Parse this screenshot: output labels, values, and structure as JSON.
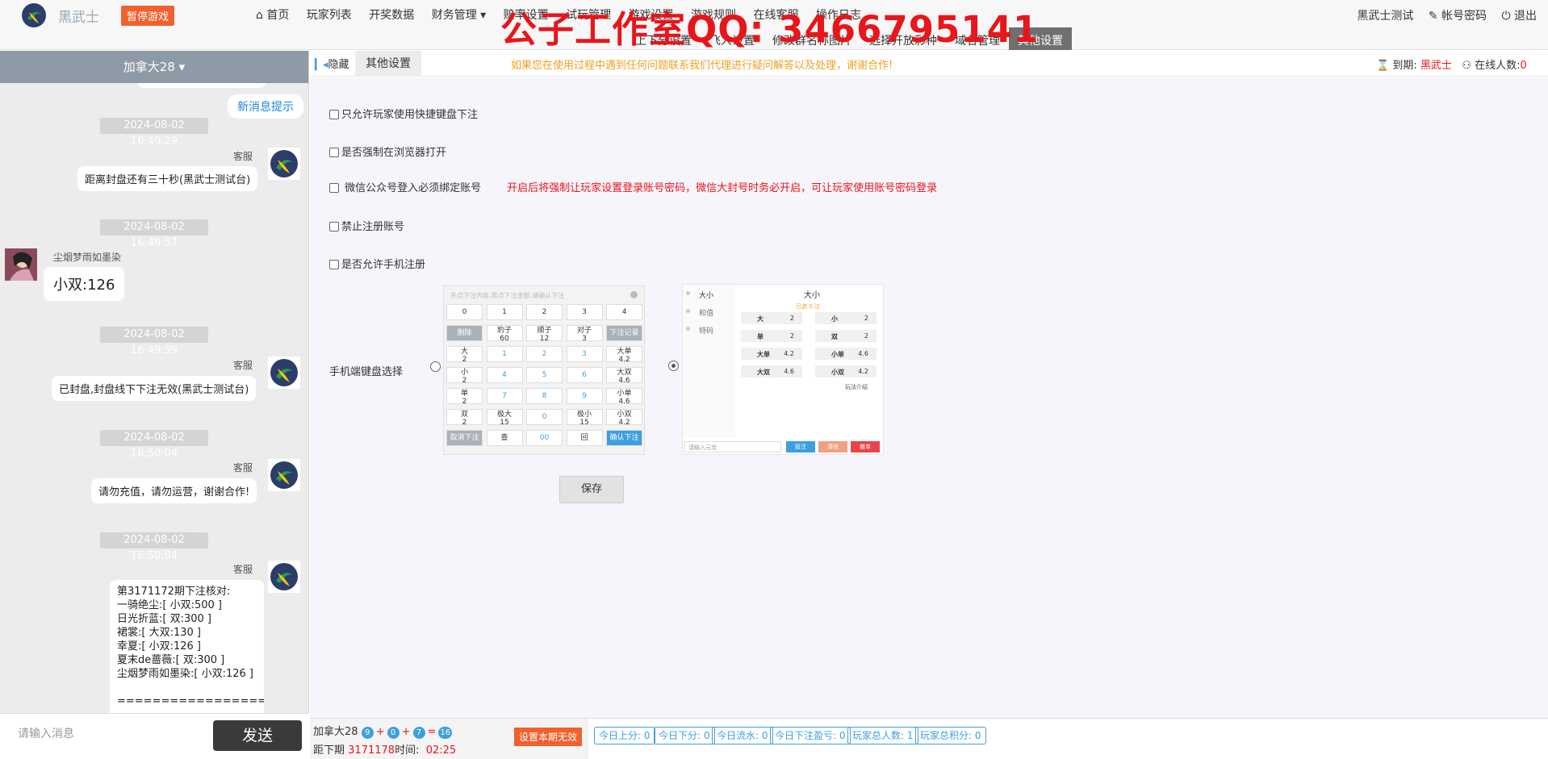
{
  "header": {
    "brand": "黑武士",
    "pause_label": "暂停游戏",
    "nav_primary": [
      "首页",
      "玩家列表",
      "开奖数据",
      "财务管理 ▾",
      "赔率设置",
      "试玩管理",
      "游戏设置",
      "游戏规则",
      "在线客服",
      "操作日志"
    ],
    "nav_secondary": [
      "上下分设置",
      "飞人设置",
      "修改群名称图片",
      "选择开放彩种",
      "域名管理",
      "其他设置"
    ],
    "watermark": "公子工作室QQ: 3466795141",
    "user_name": "黑武士测试",
    "account_pwd": "帐号密码",
    "logout": "退出"
  },
  "chat": {
    "room": "加拿大28",
    "new_msg": "新消息提示",
    "messages": [
      {
        "time": "2024-08-02 16:49:29",
        "sender": "客服",
        "text": "距离封盘还有三十秒(黑武士测试台)"
      },
      {
        "time": "2024-08-02 16:49:57",
        "sender": "尘烟梦雨如墨染",
        "text": "小双:126"
      },
      {
        "time": "2024-08-02 16:49:59",
        "sender": "客服",
        "text": "已封盘,封盘线下下注无效(黑武士测试台)"
      },
      {
        "time": "2024-08-02 16:50:04",
        "sender": "客服",
        "text": "请勿充值，请勿运营，谢谢合作!"
      },
      {
        "time": "2024-08-02 16:50:04",
        "sender": "客服",
        "text": "第3171172期下注核对:\n一骑绝尘:[ 小双:500 ]\n日光折蓝:[ 双:300 ]\n裙裳:[ 大双:130 ]\n幸夏:[ 小双:126 ]\n夏末de蔷薇:[ 双:300 ]\n尘烟梦雨如墨染:[ 小双:126 ]\n\n=================\n"
      }
    ],
    "input_placeholder": "请输入消息",
    "send_label": "发送"
  },
  "subbar": {
    "hide_label": "隐藏",
    "tab_label": "其他设置",
    "notice": "如果您在使用过程中遇到任何问题联系我们代理进行疑问解答以及处理，谢谢合作!",
    "expire_label": "到期:",
    "expire_value": "黑武士",
    "online_label": "在线人数:",
    "online_value": "0"
  },
  "options": [
    {
      "label": "只允许玩家使用快捷键盘下注"
    },
    {
      "label": "是否强制在浏览器打开"
    },
    {
      "label": "微信公众号登入必须绑定账号",
      "note": "开启后将强制让玩家设置登录账号密码，微信大封号时务必开启，可让玩家使用账号密码登录"
    },
    {
      "label": "禁止注册账号"
    },
    {
      "label": "是否允许手机注册"
    }
  ],
  "keyboard_label": "手机端键盘选择",
  "kbA": {
    "hint": "先点下注内容,再点下注金额,请确认下注",
    "keys": [
      [
        "0",
        "1",
        "2",
        "3",
        "4"
      ],
      [
        "删除",
        "豹子\n60",
        "顺子\n12",
        "对子\n3",
        "下注记录"
      ],
      [
        "大\n2",
        "1",
        "2",
        "3",
        "大单\n4.2"
      ],
      [
        "小\n2",
        "4",
        "5",
        "6",
        "大双\n4.6"
      ],
      [
        "单\n2",
        "7",
        "8",
        "9",
        "小单\n4.6"
      ],
      [
        "双\n2",
        "极大\n15",
        "0",
        "极小\n15",
        "小双\n4.2"
      ],
      [
        "取消下注",
        "查",
        "00",
        "回",
        "确认下注"
      ]
    ]
  },
  "kbB": {
    "side": [
      "大小",
      "和值",
      "特码"
    ],
    "title": "大小",
    "sub": "已选 0 注",
    "cells": [
      [
        "大",
        "2"
      ],
      [
        "小",
        "2"
      ],
      [
        "单",
        "2"
      ],
      [
        "双",
        "2"
      ],
      [
        "大单",
        "4.2"
      ],
      [
        "小单",
        "4.6"
      ],
      [
        "大双",
        "4.6"
      ],
      [
        "小双",
        "4.2"
      ]
    ],
    "rule": "玩法介绍",
    "input_placeholder": "请输入元宝",
    "btn_bet": "投注",
    "btn_clear": "清除",
    "btn_cancel": "撤单"
  },
  "save_label": "保存",
  "bottom": {
    "room": "加拿大28",
    "balls": [
      "9",
      "0",
      "7",
      "16"
    ],
    "next_label": "距下期",
    "next_period": "3171178",
    "time_label": "时间:",
    "time_value": "02:25",
    "invalid_label": "设置本期无效",
    "stats": [
      "今日上分: 0",
      "今日下分: 0",
      "今日流水: 0",
      "今日下注盈亏: 0",
      "玩家总人数: 1",
      "玩家总积分: 0"
    ]
  },
  "colors": {
    "accent": "#3e9fe0",
    "danger": "#e8151b",
    "orange": "#f0612d",
    "notice": "#f0a020"
  }
}
